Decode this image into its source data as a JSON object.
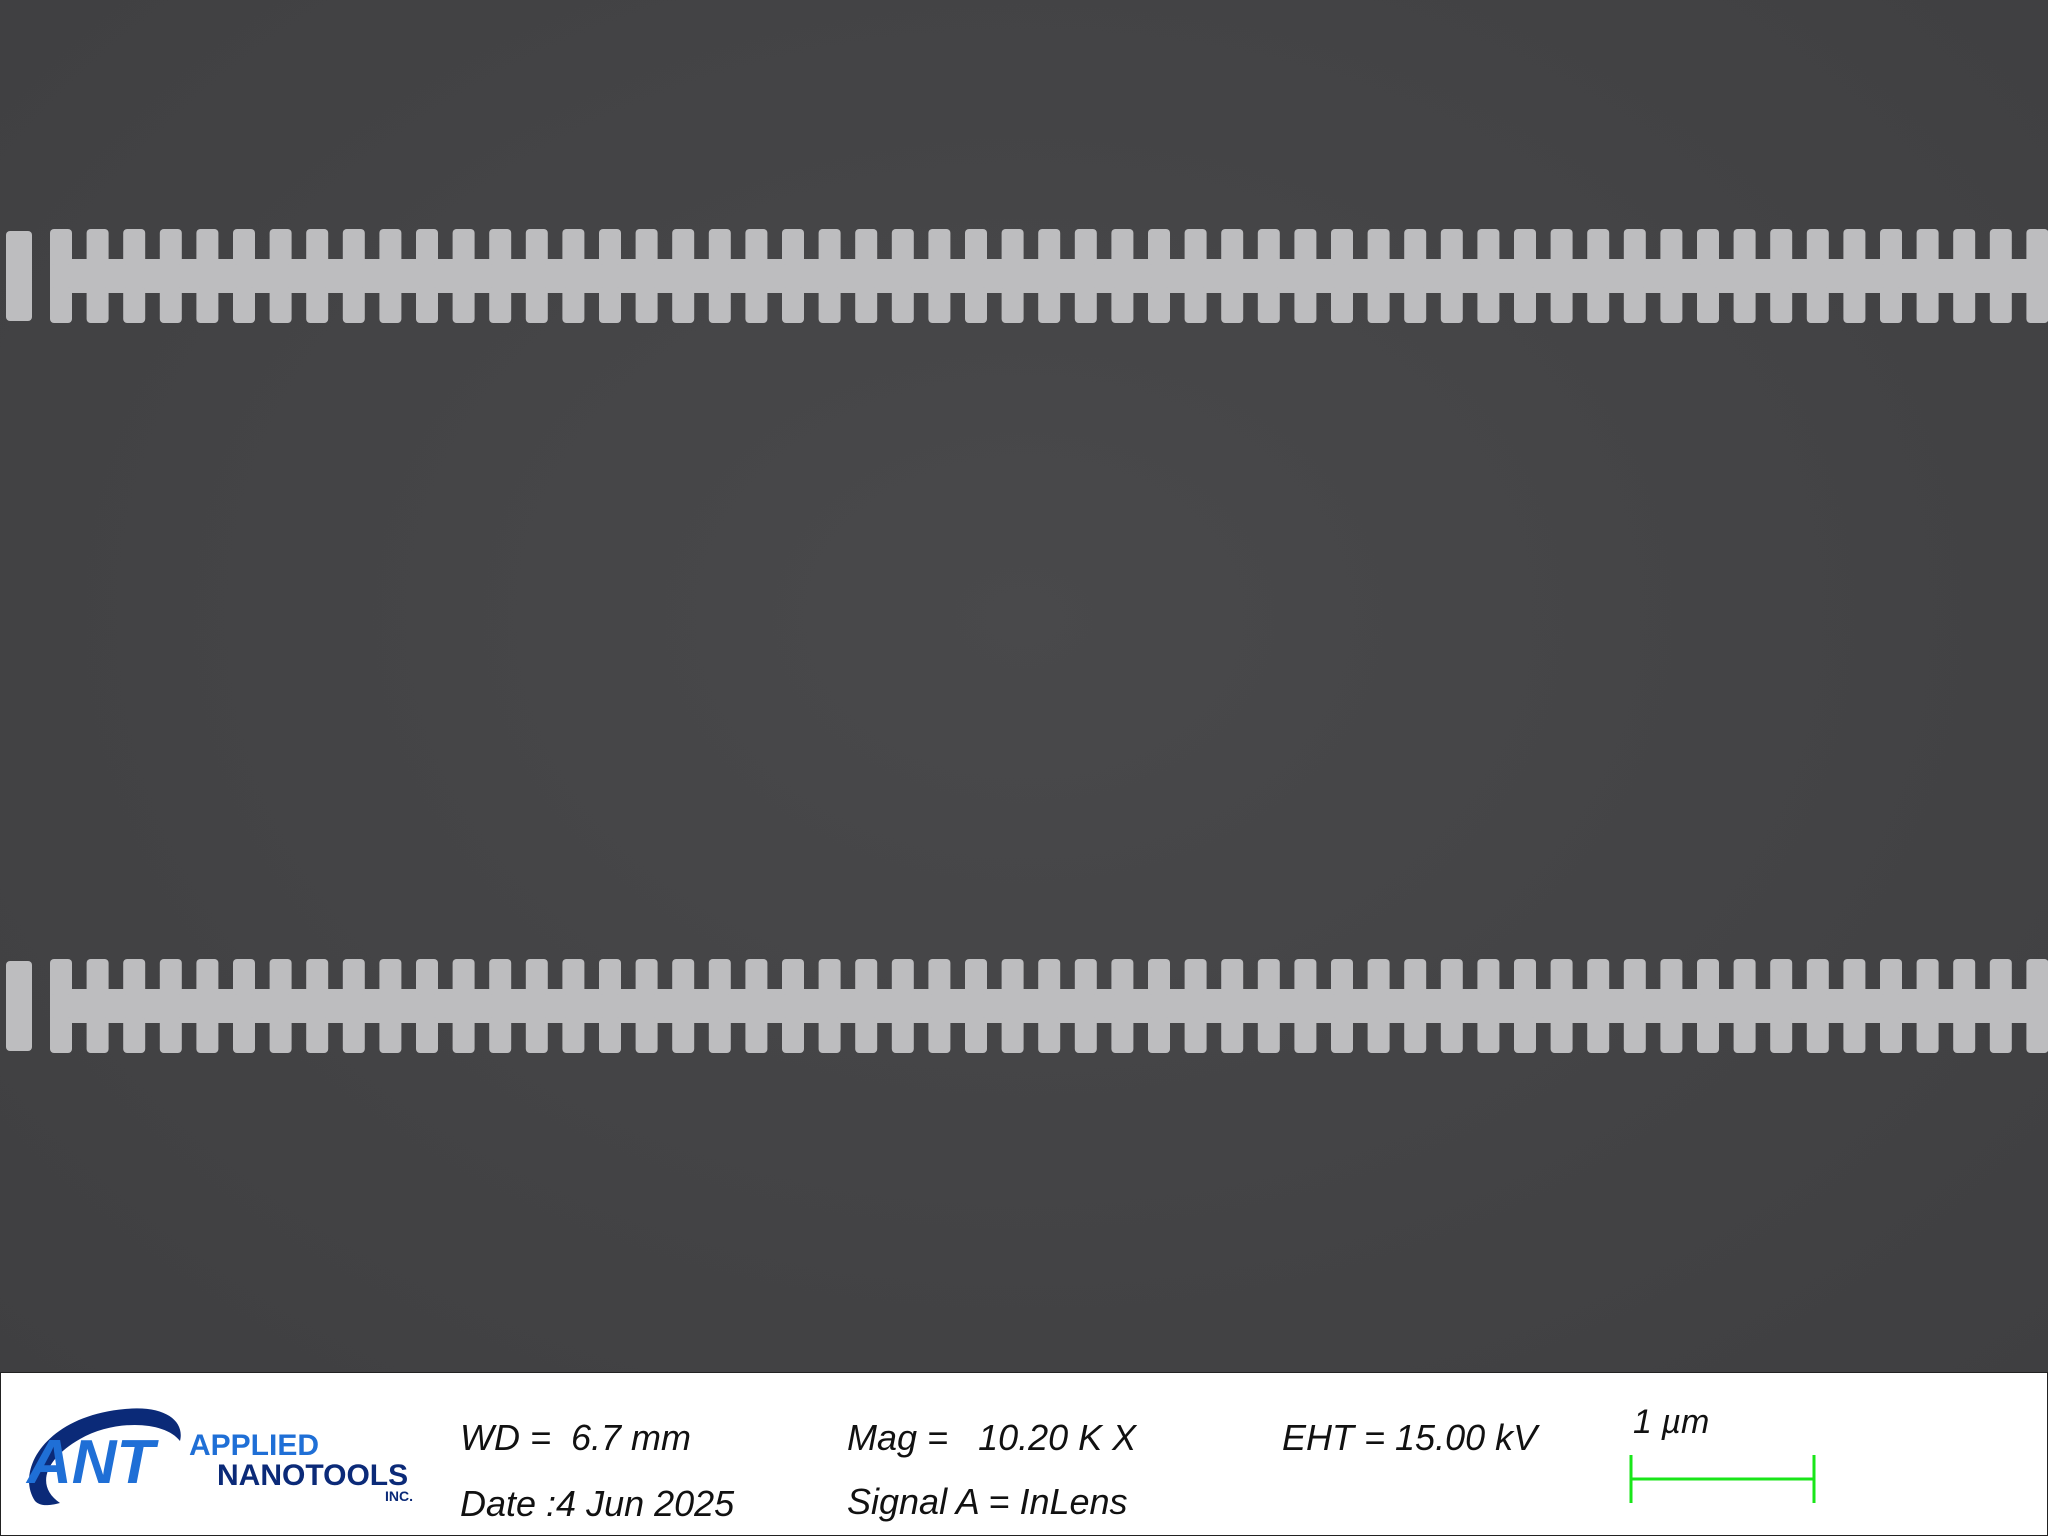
{
  "image_kind": "SEM micrograph",
  "scene": {
    "background_color": "#444446",
    "structure_color": "#bdbdbf"
  },
  "info_bar": {
    "logo": {
      "mark": "ANT",
      "line1": "APPLIED",
      "line2": "NANOTOOLS",
      "suffix": "INC.",
      "colors": {
        "mark": "#1f6fd6",
        "swoosh": "#0b2a78",
        "line1": "#1f6fd6",
        "line2": "#0b2a78"
      }
    },
    "wd": "WD =  6.7 mm",
    "date": "Date :4 Jun 2025",
    "mag": "Mag =   10.20 K X",
    "signal": "Signal A = InLens",
    "eht": "EHT = 15.00 kV",
    "scale_label": "1 µm",
    "scale_color": "#19e619"
  }
}
